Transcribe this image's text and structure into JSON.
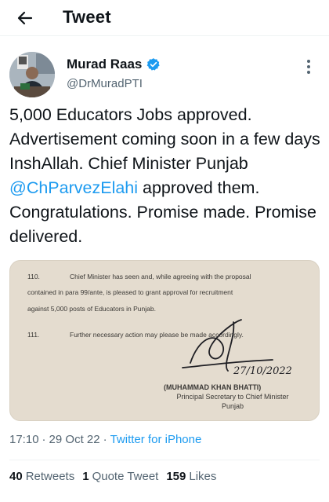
{
  "topbar": {
    "title": "Tweet",
    "back_icon": "arrow-left-icon"
  },
  "author": {
    "name": "Murad Raas",
    "handle": "@DrMuradPTI",
    "verified_icon": "verified-badge-icon",
    "verified_color": "#1d9bf0"
  },
  "tweet": {
    "text_before_mention": "5,000 Educators Jobs approved. Advertisement coming soon in a few days InshAllah. Chief Minister Punjab ",
    "mention": "@ChParvezElahi",
    "text_after_mention": " approved them. Congratulations. Promise made. Promise delivered."
  },
  "document": {
    "para_110_num": "110.",
    "para_110_line1": "Chief Minister has seen and, while agreeing with the proposal",
    "para_110_line2": "contained in para 99/ante, is pleased to grant approval for recruitment",
    "para_110_line3": "against 5,000 posts of Educators in Punjab.",
    "para_111_num": "111.",
    "para_111_line1": "Further necessary action may please be made accordingly.",
    "signature_date": "27/10/2022",
    "signatory_name": "(MUHAMMAD KHAN BHATTI)",
    "signatory_title_line1": "Principal Secretary to Chief Minister",
    "signatory_title_line2": "Punjab"
  },
  "meta": {
    "time": "17:10",
    "separator": "·",
    "date": "29 Oct 22",
    "separator2": "·",
    "source": "Twitter for iPhone"
  },
  "stats": {
    "retweets_count": "40",
    "retweets_label": "Retweets",
    "quotes_count": "1",
    "quotes_label": "Quote Tweet",
    "likes_count": "159",
    "likes_label": "Likes"
  },
  "colors": {
    "accent": "#1d9bf0",
    "text": "#0f1419",
    "muted": "#536471"
  }
}
